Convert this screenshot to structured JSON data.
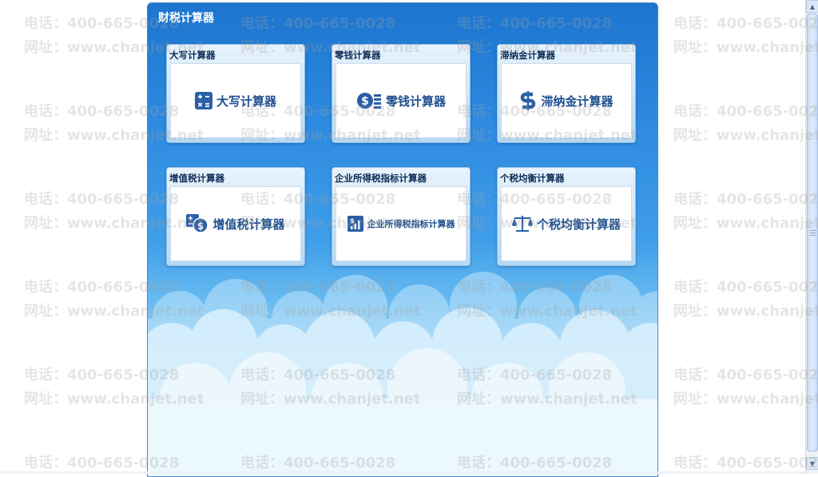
{
  "panel": {
    "title": "财税计算器"
  },
  "cards": [
    {
      "label": "大写计算器",
      "button": "大写计算器",
      "icon": "calculator-icon"
    },
    {
      "label": "零钱计算器",
      "button": "零钱计算器",
      "icon": "coin-stack-icon"
    },
    {
      "label": "滞纳金计算器",
      "button": "滞纳金计算器",
      "icon": "dollar-icon"
    },
    {
      "label": "增值税计算器",
      "button": "增值税计算器",
      "icon": "tax-coin-icon"
    },
    {
      "label": "企业所得税指标计算器",
      "button": "企业所得税指标计算器",
      "icon": "bar-chart-icon"
    },
    {
      "label": "个税均衡计算器",
      "button": "个税均衡计算器",
      "icon": "balance-scale-icon"
    }
  ],
  "watermark": {
    "phone": "电话：400-665-0028",
    "site": "网址：www.chanjet.net"
  },
  "colors": {
    "panel_blue": "#1c75cf",
    "card_text": "#1d4f8f",
    "label_text": "#0b2a55"
  }
}
